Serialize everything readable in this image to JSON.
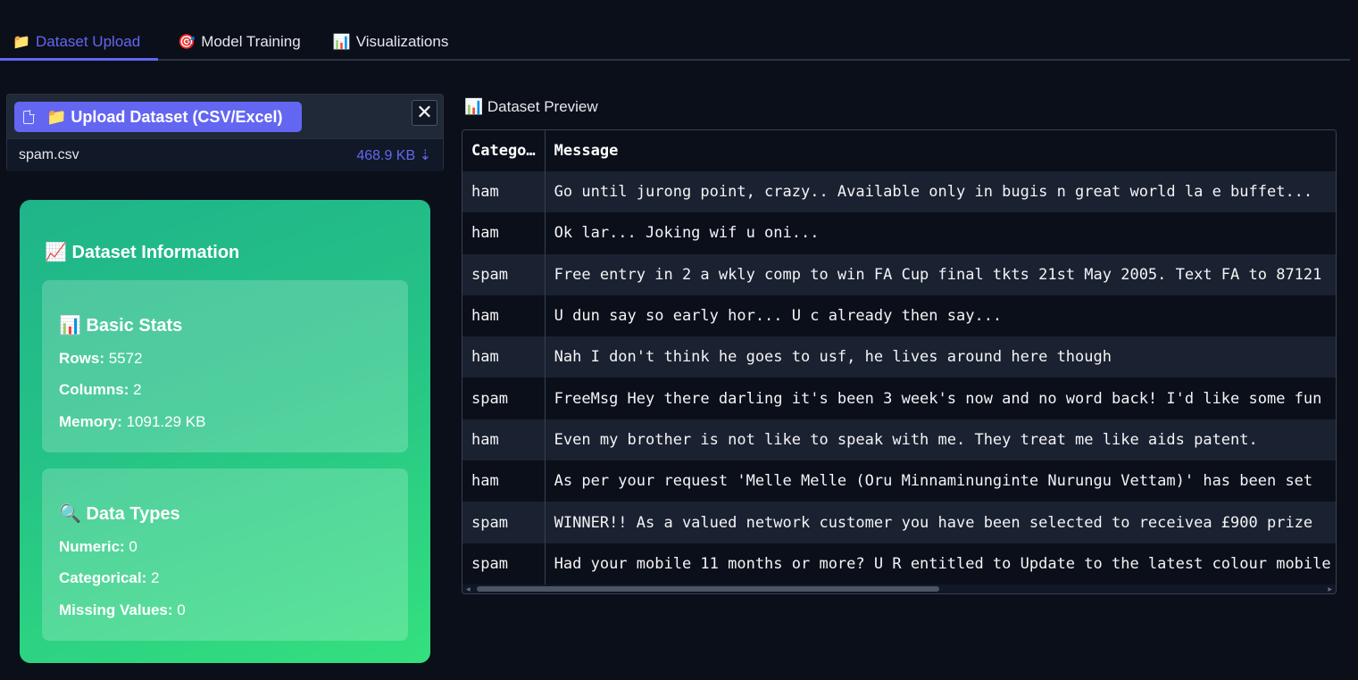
{
  "tabs": [
    {
      "icon": "📁",
      "label": "Dataset Upload"
    },
    {
      "icon": "🎯",
      "label": "Model Training"
    },
    {
      "icon": "📊",
      "label": "Visualizations"
    }
  ],
  "upload": {
    "button_label": "📁 Upload Dataset (CSV/Excel)",
    "close_icon": "✕",
    "file_name": "spam.csv",
    "file_size": "468.9 KB ⇣"
  },
  "info": {
    "title": "📈 Dataset Information",
    "basic": {
      "title": "📊 Basic Stats",
      "rows_label": "Rows:",
      "rows_value": " 5572",
      "cols_label": "Columns:",
      "cols_value": " 2",
      "mem_label": "Memory:",
      "mem_value": " 1091.29 KB"
    },
    "types": {
      "title": "🔍 Data Types",
      "num_label": "Numeric:",
      "num_value": " 0",
      "cat_label": "Categorical:",
      "cat_value": " 2",
      "miss_label": "Missing Values:",
      "miss_value": " 0"
    }
  },
  "preview": {
    "label": "📊 Dataset Preview",
    "columns": [
      "Catego…",
      "Message"
    ],
    "rows": [
      [
        "ham",
        "Go until jurong point, crazy.. Available only in bugis n great world la e buffet..."
      ],
      [
        "ham",
        "Ok lar... Joking wif u oni..."
      ],
      [
        "spam",
        "Free entry in 2 a wkly comp to win FA Cup final tkts 21st May 2005. Text FA to 87121"
      ],
      [
        "ham",
        "U dun say so early hor... U c already then say..."
      ],
      [
        "ham",
        "Nah I don't think he goes to usf, he lives around here though"
      ],
      [
        "spam",
        "FreeMsg Hey there darling it's been 3 week's now and no word back! I'd like some fun"
      ],
      [
        "ham",
        "Even my brother is not like to speak with me. They treat me like aids patent."
      ],
      [
        "ham",
        "As per your request 'Melle Melle (Oru Minnaminunginte Nurungu Vettam)' has been set"
      ],
      [
        "spam",
        "WINNER!! As a valued network customer you have been selected to receivea £900 prize"
      ],
      [
        "spam",
        "Had your mobile 11 months or more? U R entitled to Update to the latest colour mobile"
      ]
    ]
  },
  "colors": {
    "accent": "#6366f1",
    "card_start": "#1fb48a",
    "card_end": "#34e07e",
    "bg": "#0b0f19"
  }
}
